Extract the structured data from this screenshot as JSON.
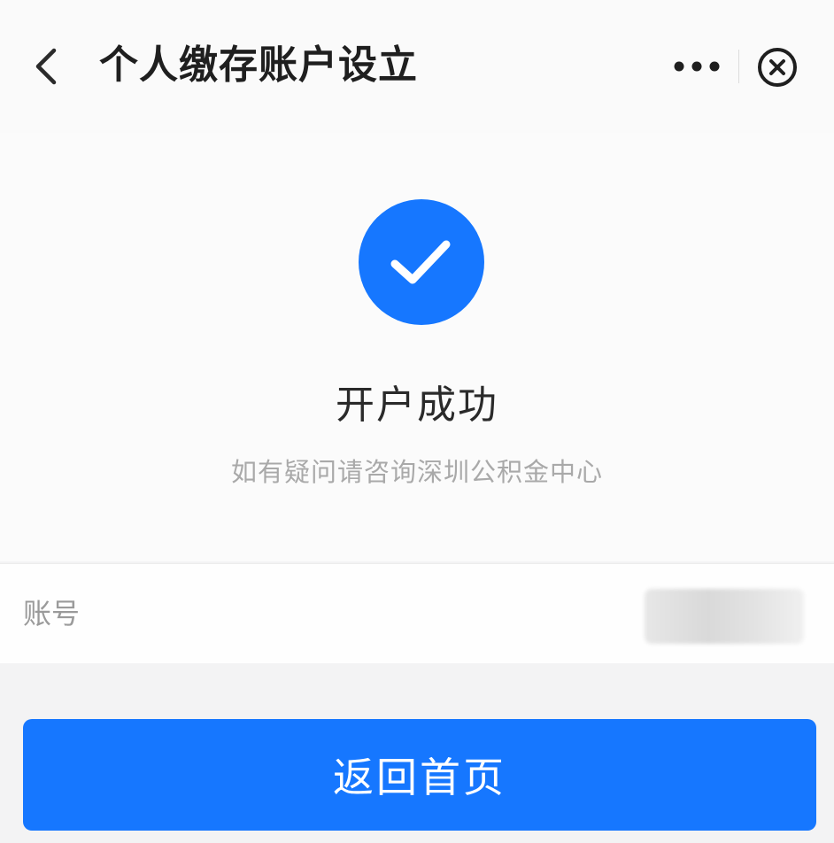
{
  "header": {
    "title": "个人缴存账户设立",
    "back_icon": "chevron-left-icon",
    "more_icon": "more-dots-icon",
    "close_icon": "close-circle-icon"
  },
  "result": {
    "icon": "check-circle-icon",
    "title": "开户成功",
    "description": "如有疑问请咨询深圳公积金中心"
  },
  "account": {
    "label": "账号"
  },
  "footer": {
    "button_label": "返回首页"
  },
  "colors": {
    "accent": "#1677ff",
    "text_primary": "#1f1f1f",
    "text_secondary": "#a9a9a9",
    "background": "#f3f3f4"
  }
}
